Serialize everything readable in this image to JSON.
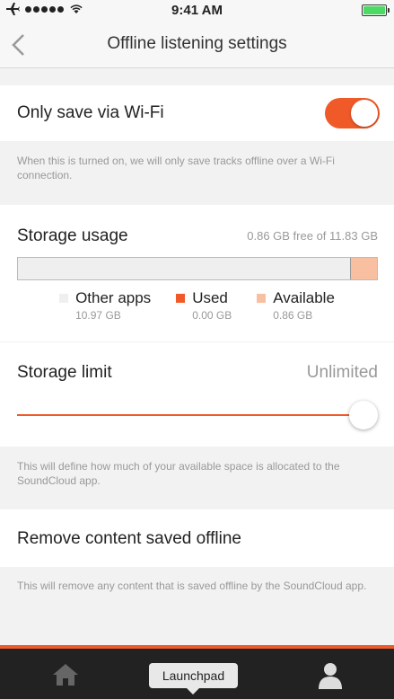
{
  "status_bar": {
    "time": "9:41 AM"
  },
  "nav": {
    "title": "Offline listening settings"
  },
  "wifi": {
    "label": "Only save via Wi-Fi",
    "enabled": true,
    "caption": "When this is turned on, we will only save tracks offline over a Wi-Fi connection."
  },
  "storage": {
    "label": "Storage usage",
    "summary": "0.86 GB free of 11.83 GB",
    "other_fraction": 0.927,
    "used_fraction": 0.0,
    "available_fraction": 0.073,
    "legend": [
      {
        "name": "Other apps",
        "value": "10.97 GB",
        "color": "#efefef"
      },
      {
        "name": "Used",
        "value": "0.00 GB",
        "color": "#f05a28"
      },
      {
        "name": "Available",
        "value": "0.86 GB",
        "color": "#f8c0a0"
      }
    ]
  },
  "limit": {
    "label": "Storage limit",
    "value": "Unlimited",
    "slider_fraction": 1.0,
    "caption": "This will define how much of your available space is allocated to the SoundCloud app."
  },
  "remove": {
    "label": "Remove content saved offline",
    "caption": "This will remove any content that is saved offline by the SoundCloud app."
  },
  "tab_bar": {
    "tooltip": "Launchpad"
  },
  "colors": {
    "accent": "#f05a28"
  }
}
